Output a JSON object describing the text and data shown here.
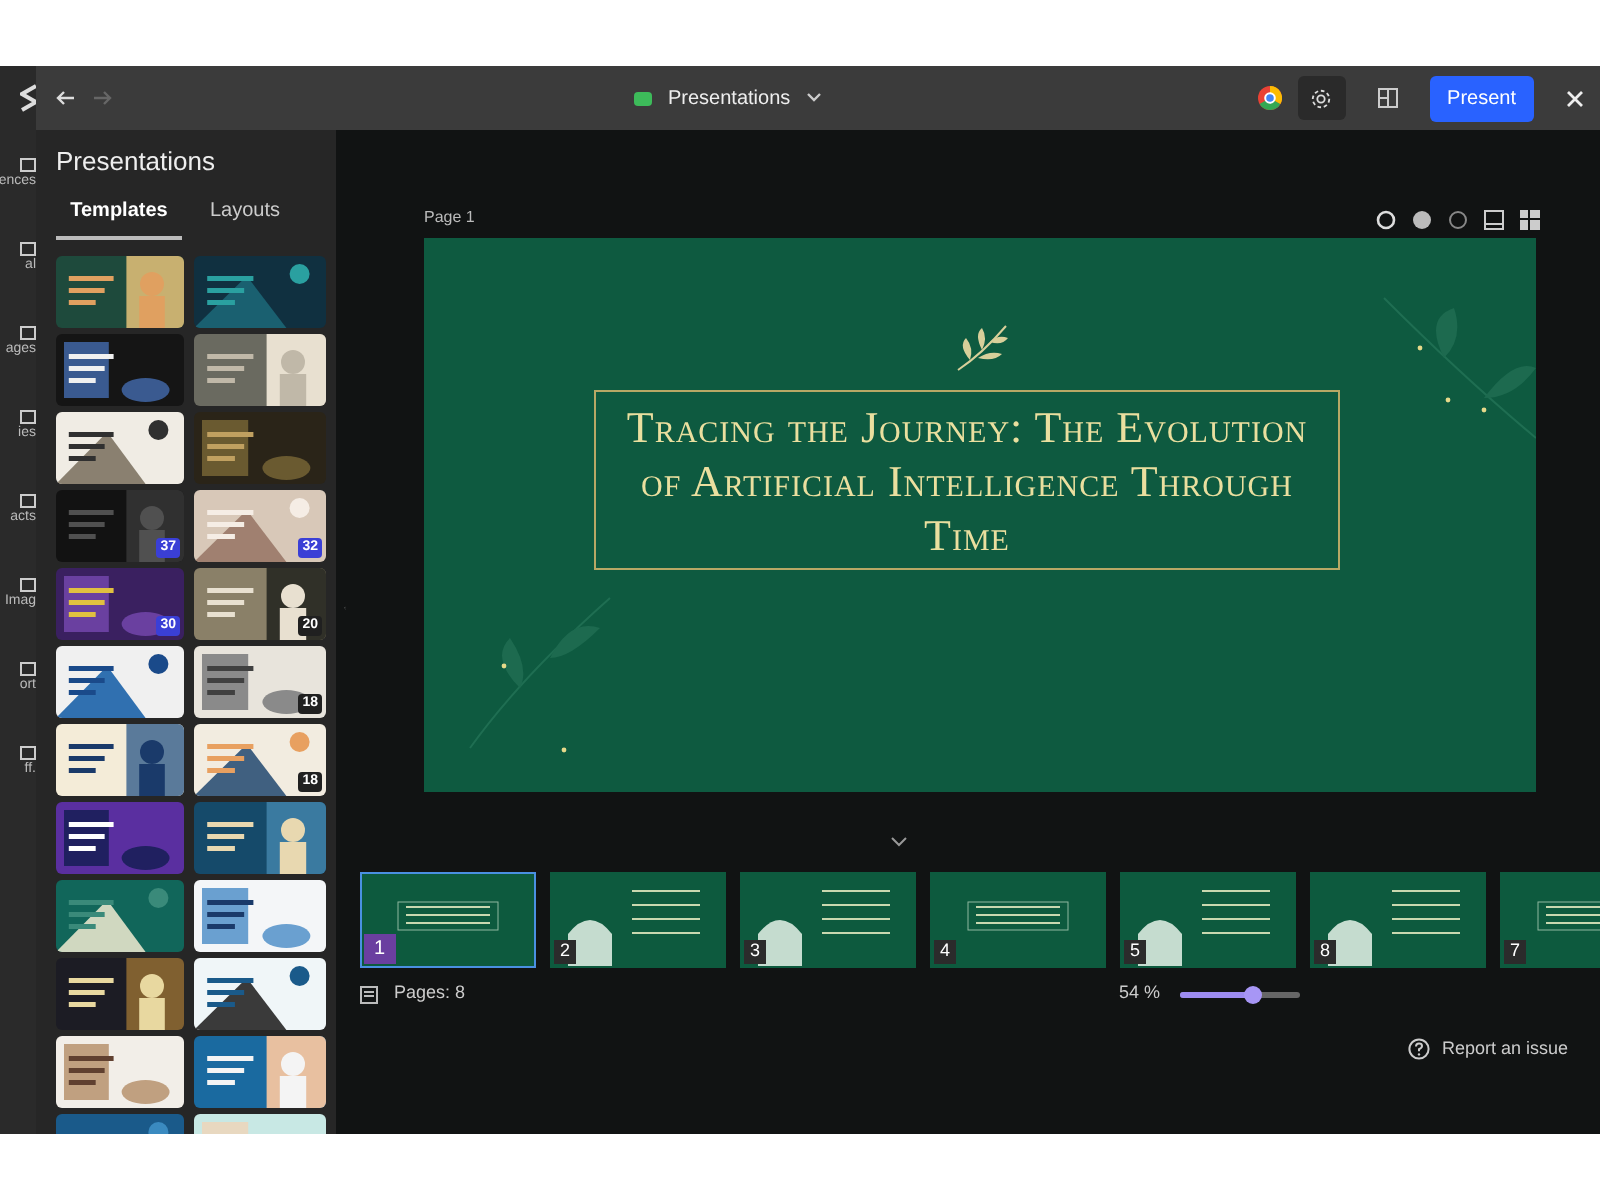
{
  "rail": {
    "items": [
      {
        "label": "ences"
      },
      {
        "label": "al"
      },
      {
        "label": "ages"
      },
      {
        "label": "ies"
      },
      {
        "label": "acts"
      },
      {
        "label": "Imag"
      },
      {
        "label": "ort"
      },
      {
        "label": "ff."
      }
    ]
  },
  "toolbar": {
    "title": "Presentations",
    "present": "Present"
  },
  "panel": {
    "title": "Presentations",
    "tabs": [
      {
        "label": "Templates",
        "selected": true
      },
      {
        "label": "Layouts",
        "selected": false
      }
    ],
    "templates": [
      {
        "kind": "picture"
      },
      {
        "kind": "picture"
      },
      {
        "kind": "picture"
      },
      {
        "kind": "picture"
      },
      {
        "kind": "picture"
      },
      {
        "kind": "picture"
      },
      {
        "kind": "picture",
        "badge": "37",
        "color": "#3a3fd6"
      },
      {
        "kind": "picture",
        "badge": "32",
        "color": "#3a3fd6"
      },
      {
        "kind": "picture",
        "badge": "30",
        "color": "#3a3fd6"
      },
      {
        "kind": "picture",
        "badge": "20",
        "color": "#202020"
      },
      {
        "kind": "picture"
      },
      {
        "kind": "picture",
        "badge": "18",
        "color": "#202020"
      },
      {
        "kind": "picture"
      },
      {
        "kind": "picture",
        "badge": "18",
        "color": "#202020"
      },
      {
        "kind": "picture"
      },
      {
        "kind": "picture"
      },
      {
        "kind": "picture"
      },
      {
        "kind": "picture"
      },
      {
        "kind": "picture"
      },
      {
        "kind": "picture"
      },
      {
        "kind": "picture"
      },
      {
        "kind": "picture"
      },
      {
        "kind": "picture"
      },
      {
        "kind": "picture"
      }
    ]
  },
  "canvas": {
    "page_label": "Page 1",
    "slide_title": "Tracing the Journey: The Evolution of Artificial Intelligence Through Time"
  },
  "filmstrip": {
    "slides": [
      {
        "number": "1",
        "selected": true
      },
      {
        "number": "2",
        "selected": false
      },
      {
        "number": "3",
        "selected": false
      },
      {
        "number": "4",
        "selected": false
      },
      {
        "number": "5",
        "selected": false
      },
      {
        "number": "8",
        "selected": false
      },
      {
        "number": "7",
        "selected": false
      }
    ]
  },
  "footer": {
    "pages": "Pages: 8",
    "zoom": {
      "reading": "54 %",
      "level": 0.6
    },
    "report": "Report an issue"
  }
}
